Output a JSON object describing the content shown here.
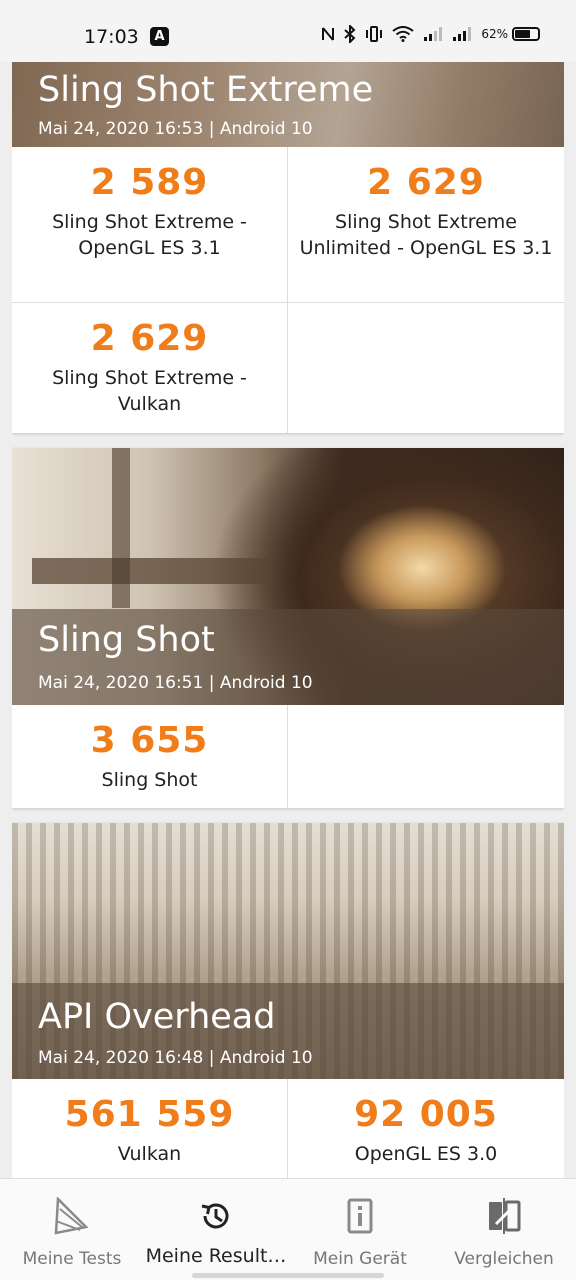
{
  "status_bar": {
    "time": "17:03",
    "battery": "62%"
  },
  "cards": [
    {
      "title": "Sling Shot Extreme",
      "subtitle": "Mai 24, 2020 16:53 | Android 10",
      "results": [
        {
          "score": "2 589",
          "label": "Sling Shot Extreme - OpenGL ES 3.1"
        },
        {
          "score": "2 629",
          "label": "Sling Shot Extreme Unlimited - OpenGL ES 3.1"
        },
        {
          "score": "2 629",
          "label": "Sling Shot Extreme - Vulkan"
        }
      ]
    },
    {
      "title": "Sling Shot",
      "subtitle": "Mai 24, 2020 16:51 | Android 10",
      "results": [
        {
          "score": "3 655",
          "label": "Sling Shot"
        }
      ]
    },
    {
      "title": "API Overhead",
      "subtitle": "Mai 24, 2020 16:48 | Android 10",
      "results": [
        {
          "score": "561 559",
          "label": "Vulkan"
        },
        {
          "score": "92 005",
          "label": "OpenGL ES 3.0"
        }
      ]
    }
  ],
  "bottom_nav": [
    {
      "label": "Meine Tests",
      "icon": "3dmark-logo-icon",
      "active": false
    },
    {
      "label": "Meine Result…",
      "icon": "history-icon",
      "active": true
    },
    {
      "label": "Mein Gerät",
      "icon": "device-info-icon",
      "active": false
    },
    {
      "label": "Vergleichen",
      "icon": "compare-icon",
      "active": false
    }
  ],
  "colors": {
    "score": "#f07d1a",
    "accent_text": "#222222"
  }
}
